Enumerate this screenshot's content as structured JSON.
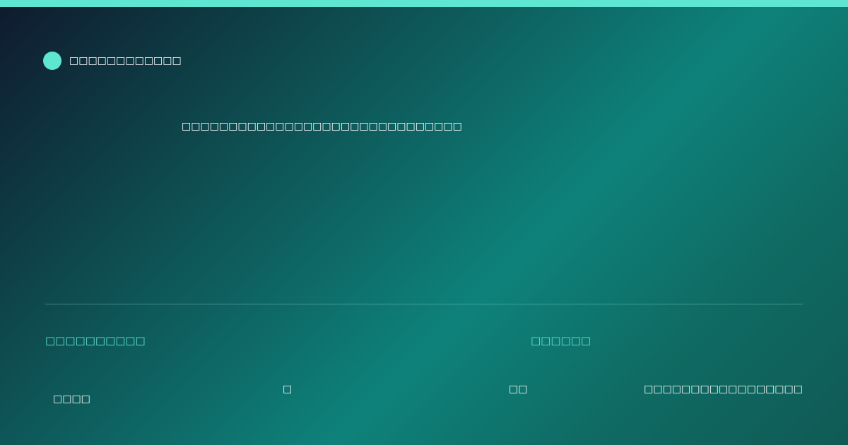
{
  "brand": {
    "name": "□□□□□□□□□□□□"
  },
  "hero": {
    "headline": "□□□□□□□□□□□□□□□□□□□□□□□□□□□□□□"
  },
  "meta": {
    "left_label": "□□□□□□□□□□",
    "right_label": "□□□□□□"
  },
  "footer": {
    "item1": "□□□□",
    "item2": "□",
    "item3": "□□",
    "item4": "□□□□□□□□□□□□□□□□□"
  },
  "colors": {
    "accent": "#5fe6d2",
    "text": "#ffffff"
  }
}
